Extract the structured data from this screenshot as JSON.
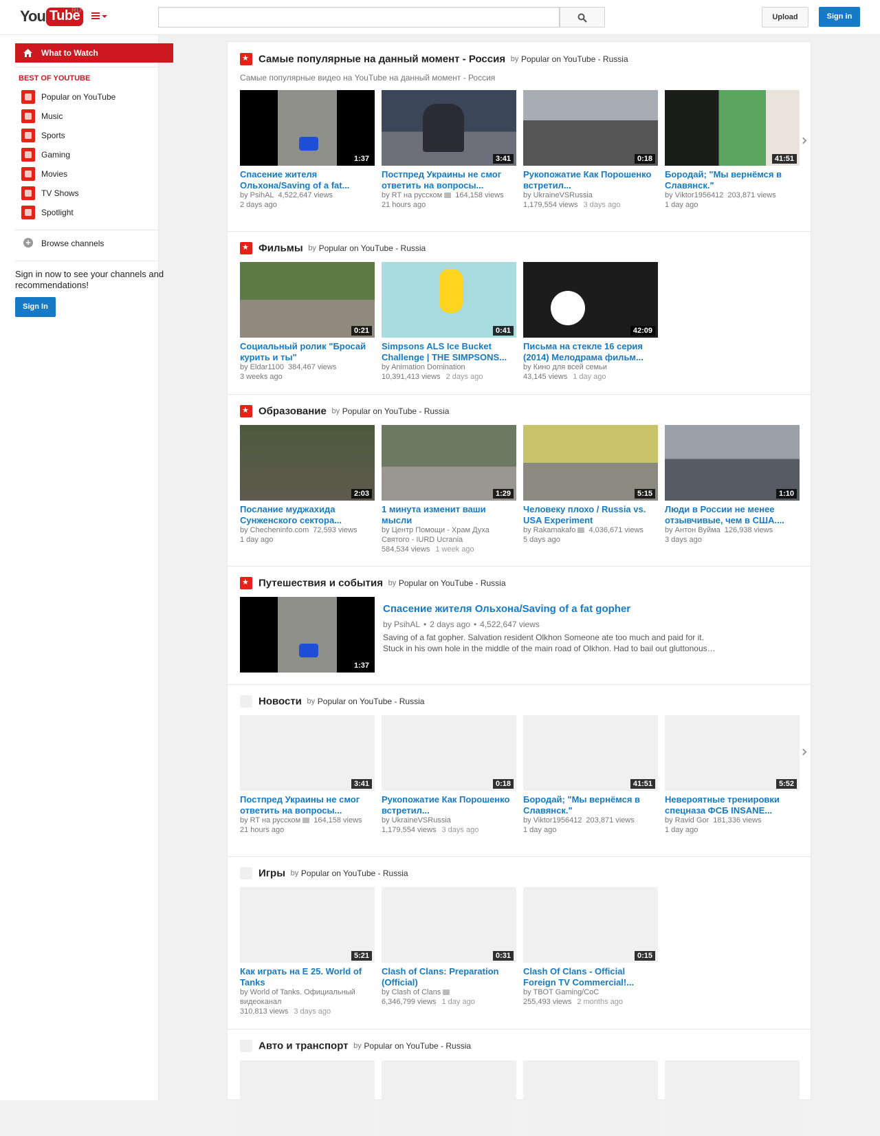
{
  "masthead": {
    "logo_you": "You",
    "logo_tube": "Tube",
    "region": "RU",
    "search_placeholder": "",
    "upload": "Upload",
    "signin": "Sign in"
  },
  "guide": {
    "what_to_watch": "What to Watch",
    "best_of": "BEST OF YOUTUBE",
    "items": [
      {
        "label": "Popular on YouTube",
        "icon": "popular-icon"
      },
      {
        "label": "Music",
        "icon": "headphones-icon"
      },
      {
        "label": "Sports",
        "icon": "trophy-icon"
      },
      {
        "label": "Gaming",
        "icon": "gamepad-icon"
      },
      {
        "label": "Movies",
        "icon": "film-reel-icon"
      },
      {
        "label": "TV Shows",
        "icon": "tv-icon"
      },
      {
        "label": "Spotlight",
        "icon": "spotlight-icon"
      }
    ],
    "browse": "Browse channels",
    "signin_note": "Sign in now to see your channels and recommendations!",
    "signin_btn": "Sign In"
  },
  "shelves": {
    "popular": {
      "title": "Самые популярные на данный момент - Россия",
      "by": "by",
      "by_name": "Popular on YouTube - Russia",
      "sub": "Самые популярные видео на YouTube на данный момент - Россия",
      "videos": [
        {
          "title": "Спасение жителя Ольхона/Saving of a fat...",
          "owner": "by PsihAL",
          "views": "4,522,647 views",
          "ago": "2 days ago",
          "duration": "1:37"
        },
        {
          "title": "Постпред Украины не смог ответить на вопросы...",
          "owner": "by RT на русском",
          "views": "164,158 views",
          "ago": "21 hours ago",
          "duration": "3:41"
        },
        {
          "title": "Рукопожатие Как Порошенко встретил...",
          "owner": "by UkraineVSRussia",
          "views": "1,179,554 views",
          "ago": "3 days ago",
          "duration": "0:18"
        },
        {
          "title": "Бородай; \"Мы вернёмся в Славянск.\"",
          "owner": "by Viktor1956412",
          "views": "203,871 views",
          "ago": "1 day ago",
          "duration": "41:51"
        }
      ]
    },
    "films": {
      "title": "Фильмы",
      "by": "by",
      "by_name": "Popular on YouTube - Russia",
      "videos": [
        {
          "title": "Социальный ролик \"Бросай курить и ты\"",
          "owner": "by Eldar1100",
          "views": "384,467 views",
          "ago": "3 weeks ago",
          "duration": "0:21"
        },
        {
          "title": "Simpsons ALS Ice Bucket Challenge | THE SIMPSONS...",
          "owner": "by Animation Domination",
          "views": "10,391,413 views",
          "ago": "2 days ago",
          "duration": "0:41"
        },
        {
          "title": "Письма на стекле 16 серия (2014) Мелодрама фильм...",
          "owner": "by Кино для всей семьи",
          "views": "43,145 views",
          "ago": "1 day ago",
          "duration": "42:09"
        }
      ]
    },
    "education": {
      "title": "Образование",
      "by": "by",
      "by_name": "Popular on YouTube - Russia",
      "videos": [
        {
          "title": "Послание муджахида Сунженского сектора...",
          "owner": "by Checheninfo.com",
          "views": "72,593 views",
          "ago": "1 day ago",
          "duration": "2:03"
        },
        {
          "title": "1 минута изменит ваши мысли",
          "owner": "by Центр Помощи - Храм Духа Святого - IURD Ucrania",
          "views": "584,534 views",
          "ago": "1 week ago",
          "duration": "1:29"
        },
        {
          "title": "Человеку плохо / Russia vs. USA Experiment",
          "owner": "by Rakamakafo",
          "views": "4,036,671 views",
          "ago": "5 days ago",
          "duration": "5:15"
        },
        {
          "title": "Люди в России не менее отзывчивые, чем в США....",
          "owner": "by Антон Вуйма",
          "views": "126,938 views",
          "ago": "3 days ago",
          "duration": "1:10"
        }
      ]
    },
    "travel": {
      "title": "Путешествия и события",
      "by": "by",
      "by_name": "Popular on YouTube - Russia",
      "featured": {
        "title": "Спасение жителя Ольхона/Saving of a fat gopher",
        "owner": "by PsihAL",
        "ago": "2 days ago",
        "views": "4,522,647 views",
        "dot": "•",
        "duration": "1:37",
        "desc1": "Saving of a fat gopher. Salvation resident Olkhon Someone ate too much and paid for it.",
        "desc2": "Stuck in his own hole in the middle of the main road of Olkhon. Had to bail out gluttonous…"
      }
    },
    "news": {
      "title": "Новости",
      "by": "by",
      "by_name": "Popular on YouTube - Russia",
      "videos": [
        {
          "title": "Постпред Украины не смог ответить на вопросы...",
          "owner": "by RT на русском",
          "views": "164,158 views",
          "ago": "21 hours ago",
          "duration": "3:41"
        },
        {
          "title": "Рукопожатие Как Порошенко встретил...",
          "owner": "by UkraineVSRussia",
          "views": "1,179,554 views",
          "ago": "3 days ago",
          "duration": "0:18"
        },
        {
          "title": "Бородай; \"Мы вернёмся в Славянск.\"",
          "owner": "by Viktor1956412",
          "views": "203,871 views",
          "ago": "1 day ago",
          "duration": "41:51"
        },
        {
          "title": "Невероятные тренировки спецназа ФСБ INSANE...",
          "owner": "by Ravid Gor",
          "views": "181,336 views",
          "ago": "1 day ago",
          "duration": "5:52"
        }
      ]
    },
    "games": {
      "title": "Игры",
      "by": "by",
      "by_name": "Popular on YouTube - Russia",
      "videos": [
        {
          "title": "Как играть на Е 25. World of Tanks",
          "owner": "by World of Tanks. Официальный видеоканал",
          "views": "310,813 views",
          "ago": "3 days ago",
          "duration": "5:21"
        },
        {
          "title": "Clash of Clans: Preparation (Official)",
          "owner": "by Clash of Clans",
          "views": "6,346,799 views",
          "ago": "1 day ago",
          "duration": "0:31"
        },
        {
          "title": "Clash Of Clans - Official Foreign TV Commercial!...",
          "owner": "by TBOT Gaming/CoC",
          "views": "255,493 views",
          "ago": "2 months ago",
          "duration": "0:15"
        }
      ]
    },
    "auto": {
      "title": "Авто и транспорт",
      "by": "by",
      "by_name": "Popular on YouTube - Russia"
    }
  },
  "colors": {
    "brand_red": "#cc181e",
    "link_blue": "#167ac6"
  }
}
